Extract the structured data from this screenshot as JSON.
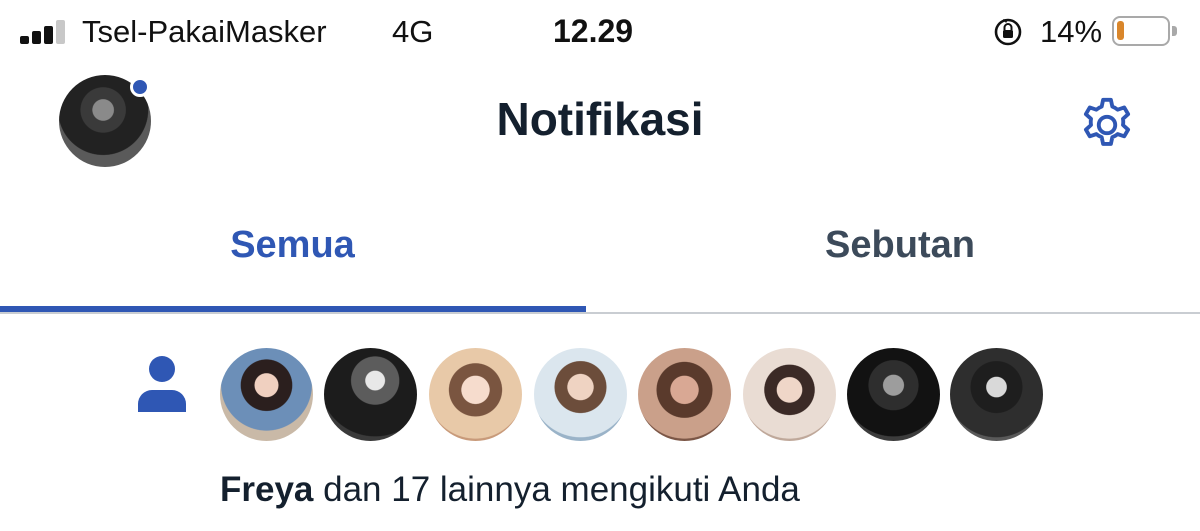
{
  "status_bar": {
    "carrier": "Tsel-PakaiMasker",
    "network": "4G",
    "time": "12.29",
    "battery_percent": "14%",
    "battery_level": 0.14,
    "battery_fill_color": "#d9862b"
  },
  "header": {
    "title": "Notifikasi",
    "accent_color": "#2f57b4"
  },
  "tabs": [
    {
      "label": "Semua",
      "active": true
    },
    {
      "label": "Sebutan",
      "active": false
    }
  ],
  "notification": {
    "icon": "person-icon",
    "avatar_count": 8,
    "actor": "Freya",
    "message": " dan 17 lainnya mengikuti Anda"
  }
}
